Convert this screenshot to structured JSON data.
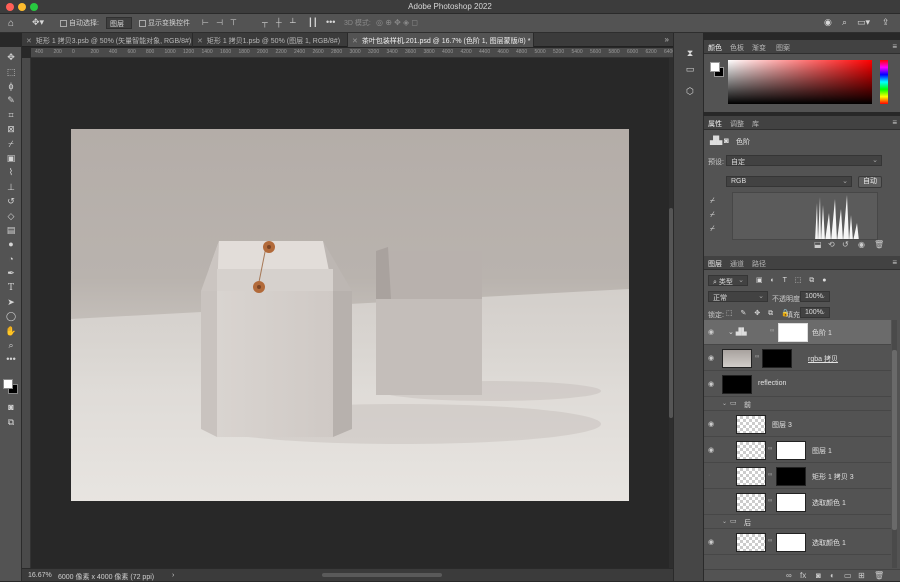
{
  "window": {
    "title": "Adobe Photoshop 2022"
  },
  "options_bar": {
    "auto_select_label": "自动选择:",
    "auto_select_value": "图层",
    "show_transform_label": "显示变换控件",
    "mode_3d_label": "3D 模式:"
  },
  "document_tabs": [
    {
      "label": "矩形 1 拷贝3.psb @ 50% (矢量智能对象, RGB/8#)",
      "active": false
    },
    {
      "label": "矩形 1 拷贝1.psb @ 50% (图层 1, RGB/8#)",
      "active": false
    },
    {
      "label": "茶叶包装样机.201.psd @ 16.7% (色阶 1, 图层蒙版/8) *",
      "active": true
    }
  ],
  "ruler": {
    "ticks": [
      "400",
      "200",
      "0",
      "200",
      "400",
      "600",
      "800",
      "1000",
      "1200",
      "1400",
      "1600",
      "1800",
      "2000",
      "2200",
      "2400",
      "2600",
      "2800",
      "3000",
      "3200",
      "3400",
      "3600",
      "3800",
      "4000",
      "4200",
      "4400",
      "4600",
      "4800",
      "5000",
      "5200",
      "5400",
      "5600",
      "5800",
      "6000",
      "6200",
      "6400"
    ]
  },
  "status_bar": {
    "zoom": "16.67%",
    "doc_info": "6000 像素 x 4000 像素 (72 ppi)"
  },
  "color_panel": {
    "tabs": [
      "颜色",
      "色板",
      "渐变",
      "图案"
    ],
    "colors": {
      "field_top_left": "#ffffff",
      "field_top_right": "#ff0000",
      "foreground": "#ffffff",
      "background": "#000000"
    }
  },
  "properties_panel": {
    "tabs": [
      "属性",
      "调整",
      "库"
    ],
    "adjustment_name": "色阶",
    "preset_label": "预设:",
    "preset_value": "自定",
    "channel_value": "RGB",
    "auto_button": "自动"
  },
  "layers_panel": {
    "tabs": [
      "图层",
      "通道",
      "路径"
    ],
    "filter_value": "类型",
    "blend_mode": "正常",
    "opacity_label": "不透明度:",
    "opacity_value": "100%",
    "lock_label": "锁定:",
    "fill_label": "填充:",
    "fill_value": "100%",
    "layers": [
      {
        "name": "色阶 1",
        "kind": "adjustment",
        "selected": true
      },
      {
        "name": "rgba 拷贝",
        "kind": "image-mask",
        "selected": false
      },
      {
        "name": "reflection",
        "kind": "black",
        "selected": false
      },
      {
        "name": "前",
        "kind": "group"
      },
      {
        "name": "图层 3",
        "kind": "transparent",
        "selected": false
      },
      {
        "name": "图层 1",
        "kind": "smart-mask",
        "selected": false
      },
      {
        "name": "矩形 1 拷贝 3",
        "kind": "smart-mask-black",
        "selected": false
      },
      {
        "name": "选取颜色 1",
        "kind": "smart-mask-white",
        "selected": false
      },
      {
        "name": "后",
        "kind": "group"
      },
      {
        "name": "选取颜色 1",
        "kind": "smart-mask-white",
        "selected": false
      }
    ]
  }
}
